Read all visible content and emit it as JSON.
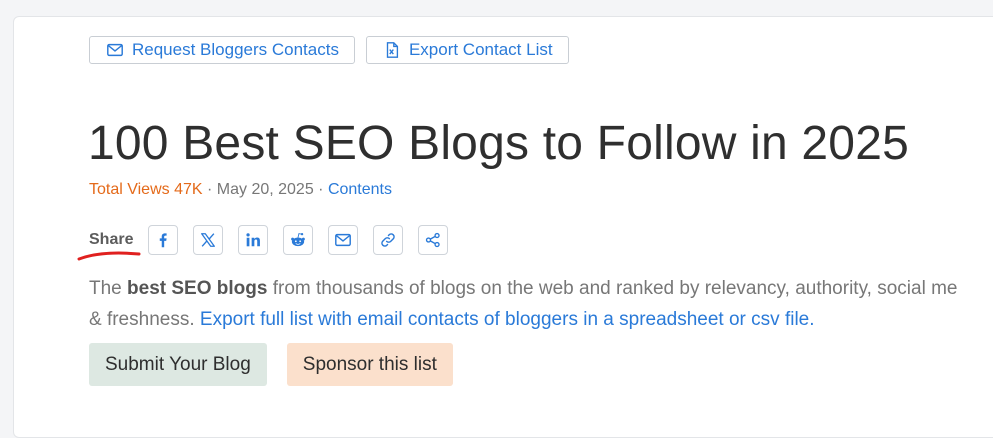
{
  "top_actions": {
    "request_label": "Request Bloggers Contacts",
    "export_label": "Export Contact List"
  },
  "article": {
    "title": "100 Best SEO Blogs to Follow in 2025",
    "meta": {
      "views": "Total Views 47K",
      "sep1": " · ",
      "date": "May 20, 2025",
      "sep2": " · ",
      "contents_link": "Contents"
    }
  },
  "share": {
    "label": "Share",
    "buttons": [
      "facebook-icon",
      "x-icon",
      "linkedin-icon",
      "reddit-icon",
      "email-icon",
      "link-icon",
      "share-icon"
    ]
  },
  "description": {
    "intro": "The ",
    "bold": "best SEO blogs",
    "rest_line1": " from thousands of blogs on the web and ranked by relevancy, authority, social me",
    "line2_start": "& freshness. ",
    "link": "Export full list with email contacts of bloggers in a spreadsheet or csv file."
  },
  "bottom_actions": {
    "submit_label": "Submit Your Blog",
    "sponsor_label": "Sponsor this list"
  },
  "colors": {
    "accent": "#2a7ad8",
    "views": "#e46a1a",
    "underline": "#e0201f",
    "submit_bg": "#dde8e2",
    "sponsor_bg": "#fbe0cc"
  }
}
